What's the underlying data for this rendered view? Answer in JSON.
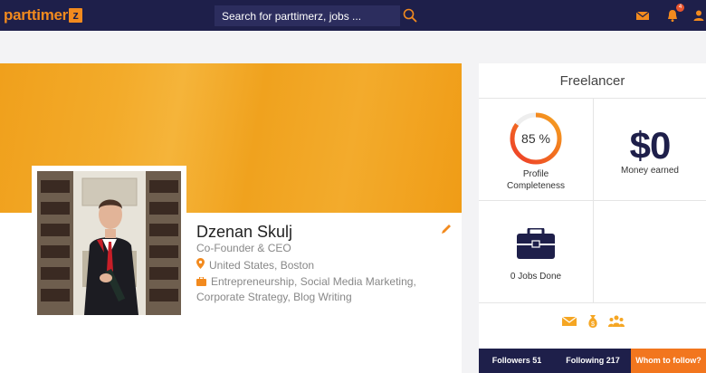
{
  "header": {
    "logo_text": "parttimer",
    "logo_badge": "z",
    "search_placeholder": "Search for parttimerz, jobs ...",
    "notification_count": "4",
    "accent_color": "#f28a1e",
    "nav_bg": "#1e1f4a",
    "icons": [
      "search-icon",
      "mail-icon",
      "bell-icon",
      "user-icon"
    ]
  },
  "profile": {
    "name": "Dzenan Skulj",
    "role": "Co-Founder & CEO",
    "location": "United States, Boston",
    "skills": "Entrepreneurship, Social Media Marketing, Corporate Strategy, Blog Writing"
  },
  "stats": {
    "title": "Freelancer",
    "completeness_value": 85,
    "completeness_label": "85 %",
    "completeness_caption_1": "Profile",
    "completeness_caption_2": "Completeness",
    "money": "$0",
    "money_caption": "Money earned",
    "jobs_caption": "0 Jobs Done",
    "action_icons": [
      "mail-icon",
      "money-bag-icon",
      "group-icon"
    ],
    "followers": "Followers 51",
    "following": "Following 217",
    "whom_to_follow": "Whom to follow?"
  }
}
